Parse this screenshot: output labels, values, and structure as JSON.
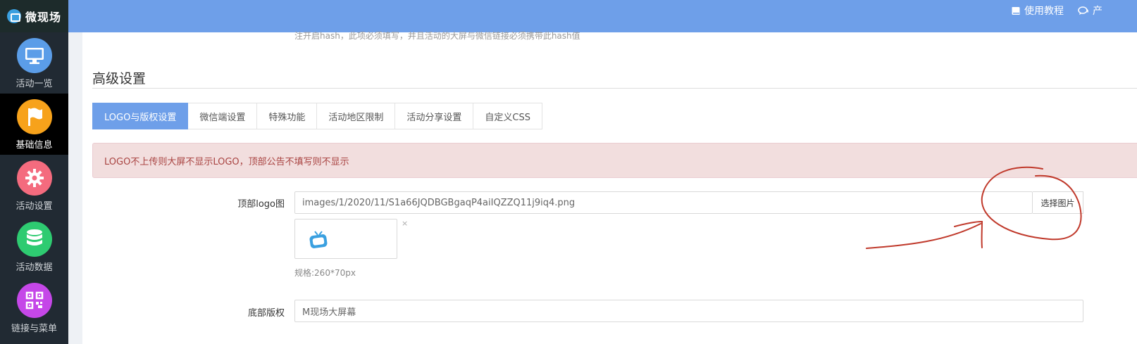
{
  "app": {
    "name": "微现场"
  },
  "sidebar": {
    "items": [
      {
        "label": "活动一览",
        "icon": "monitor-icon",
        "color": "#5b9de8",
        "active": false
      },
      {
        "label": "基础信息",
        "icon": "flag-icon",
        "color": "#f7a21b",
        "active": true
      },
      {
        "label": "活动设置",
        "icon": "gear-icon",
        "color": "#f46b7e",
        "active": false
      },
      {
        "label": "活动数据",
        "icon": "database-icon",
        "color": "#2ecb71",
        "active": false
      },
      {
        "label": "链接与菜单",
        "icon": "qrcode-icon",
        "color": "#c547e8",
        "active": false
      }
    ]
  },
  "topbar": {
    "tutorial_label": "使用教程",
    "product_label": "产"
  },
  "main": {
    "truncated_note": "注开启hash，此项必须填写，并且活动的大屏与微信链接必须携带此hash值",
    "section_title": "高级设置",
    "tabs": [
      {
        "label": "LOGO与版权设置",
        "active": true
      },
      {
        "label": "微信端设置",
        "active": false
      },
      {
        "label": "特殊功能",
        "active": false
      },
      {
        "label": "活动地区限制",
        "active": false
      },
      {
        "label": "活动分享设置",
        "active": false
      },
      {
        "label": "自定义CSS",
        "active": false
      }
    ],
    "alert_text": "LOGO不上传则大屏不显示LOGO，顶部公告不填写则不显示",
    "logo_field": {
      "label": "顶部logo图",
      "value": "images/1/2020/11/S1a66JQDBGBgaqP4aiIQZZQ11j9iq4.png",
      "pick_button": "选择图片",
      "remove": "×",
      "spec": "规格:260*70px"
    },
    "copyright_field": {
      "label": "底部版权",
      "value": "M现场大屏幕"
    }
  },
  "colors": {
    "brand": "#6e9fe9",
    "alert_bg": "#f2dede",
    "alert_text": "#a94442",
    "annotation": "#c0392b"
  }
}
